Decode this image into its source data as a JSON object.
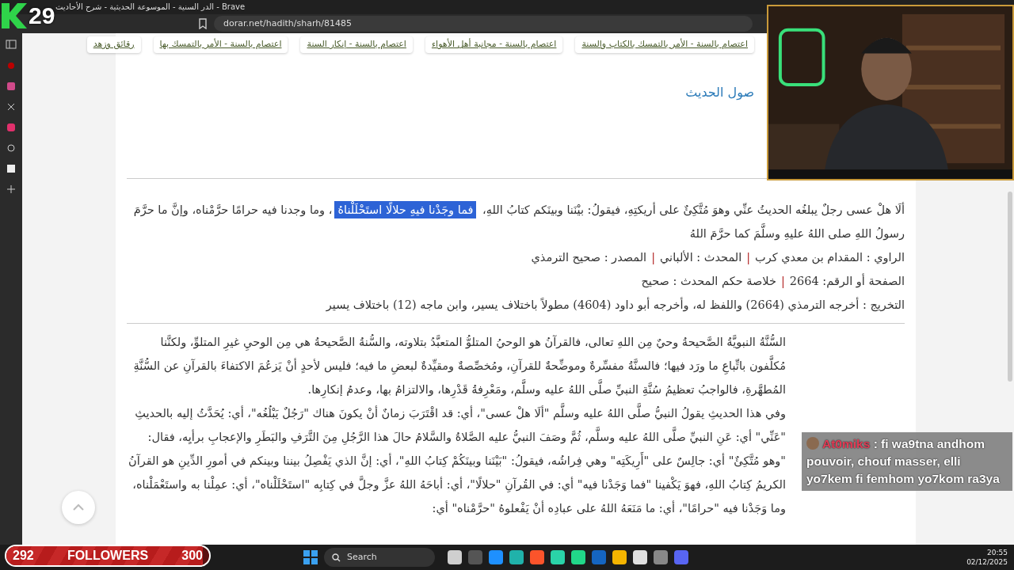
{
  "browser": {
    "title": "الدر السنية - الموسوعة الحديثية - شرح الأحاديث - Brave",
    "url": "dorar.net/hadith/sharh/81485"
  },
  "stream_overlay": {
    "counter": "29",
    "chat": {
      "user": "At0miks",
      "message": ": fi wa9tna andhom pouvoir, chouf masser, elli yo7kem fi femhom yo7kom ra3ya"
    },
    "followers": {
      "count": "292",
      "label": "FOLLOWERS",
      "goal": "300",
      "level": 0.97
    }
  },
  "tags": [
    "اعتصام بالسنة - الأمر بالتمسك بالكتاب والسنة",
    "اعتصام بالسنة - مجانبة أهل الأهواء",
    "اعتصام بالسنة - إنكار السنة",
    "اعتصام بالسنة - الأمر بالتمسك بها",
    "رقائق وزهد"
  ],
  "link": "صول الحديث",
  "hadith": {
    "segments": [
      {
        "text": "ألَا هلْ عسى رجلٌ يبلغُه الحديثُ عنِّي وهوَ مُتَّكِئٌ على أريكتِهِ، فيقولُ: بيْنَنا وبينَكم كتابُ اللهِ، ",
        "selected": false
      },
      {
        "text": "فما وجَدْنا فيهِ حلالًا استَحْلَلْناهُ",
        "selected": true
      },
      {
        "text": "، وما وجدنا فيه حرامًا حرَّمْناه، وإنَّ ما حرَّمَ رسولُ اللهِ صلى اللهُ عليهِ وسلَّمَ كما حرَّمَ اللهُ",
        "selected": false
      }
    ]
  },
  "info": [
    [
      {
        "label": "الراوي :",
        "value": "المقدام بن معدي كرب"
      },
      {
        "separator": "|",
        "label": "المحدث :",
        "value": "الألباني"
      },
      {
        "separator": "|",
        "label": "المصدر :",
        "value": "صحيح الترمذي"
      }
    ],
    [
      {
        "label": "الصفحة أو الرقم:",
        "value": "2664"
      },
      {
        "separator": "|",
        "label": "خلاصة حكم المحدث :",
        "value": "صحيح"
      }
    ],
    [
      {
        "label": "التخريج :",
        "value": "أخرجه الترمذي (2664) واللفظ له، وأخرجه أبو داود (4604) مطولاً باختلاف يسير، وابن ماجه (12) باختلاف يسير"
      }
    ]
  ],
  "sharh": [
    "السُّنَّةُ النبويَّةُ الصَّحيحةُ وحيٌ مِن اللهِ تعالى، فالقرآنُ هو الوحيُ المتلوُّ المتعبَّدُ بتلاوته، والسُّنةُ الصَّحيحةُ هي مِن الوحيِ غيرِ المتلوِّ، ولكنَّنا مُكلَّفون باتِّباعِ ما ورَد فيها؛ فالسنَّةُ مفسِّرةٌ وموضِّحةٌ للقرآنِ، ومُخصِّصةٌ ومقيِّدةٌ لبعضِ ما فيه؛ فليس لأحدٍ أنْ يَزعُمَ الاكتفاءَ بالقرآنِ عن السُّنَّةِ المُطهَّرةِ، فالواجبُ تعظيمُ سُنَّةِ النبيِّ صلَّى اللهُ عليه وسلَّم، ومَعْرِفةُ قَدْرِها، والالتزامُ بها، وعدمُ إنكارِها.",
    "وفي هذا الحديثِ يقولُ النبيُّ صلَّى اللهُ عليه وسلَّم \"ألَا هلْ عسى\"، أي: قد اقْتَرَبَ زمانٌ أنْ يكونَ هناك \"رَجُلٌ يَبْلُغُه\"، أي: يُحَدَّثُ إليه بالحديثِ \"عَنِّي\" أي: عَنِ النبيِّ صلَّى اللهُ عليه وسلَّم، ثُمَّ وصَفَ النبيُّ عليه الصَّلاةُ والسَّلامُ حالَ هذا الرَّجُلِ مِنَ التَّرَفِ والبَطَرِ والإعجابِ برأيِه، فقال: \"وهو مُتَّكِئٌ\" أي: جالِسٌ على \"أَرِيكَتِه\" وهي فِراشُه، فيقولُ: \"بَيْنَنا وبينَكُمْ كِتابُ اللهِ\"، أي: إنَّ الذي يَفْصِلُ بيننا وبينكم في أمورِ الدِّينِ هو القرآنُ الكريمُ كِتابُ اللهِ، فهوَ يَكْفينا \"فما وَجَدْنا فيه\" أي: في القُرآنِ \"حلالًا\"، أي: أباحَهُ اللهُ عزَّ وجلَّ في كِتابِه \"استَحْلَلْناه\"، أي: عمِلْنا به واستَعْمَلْناه، وما وَجَدْنا فيه \"حرامًا\"، أي: ما مَنَعَهُ اللهُ على عبادِه أنْ يَفْعلوهُ \"حرَّمْناه\" أي:"
  ],
  "taskbar": {
    "search": "Search",
    "time": "20:55",
    "date": "02/12/2025"
  }
}
